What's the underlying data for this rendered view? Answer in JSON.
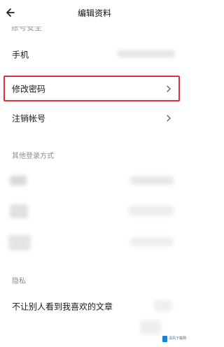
{
  "header": {
    "title": "编辑资料",
    "back": "back-arrow-icon"
  },
  "account_section_partial": "账号安全",
  "rows": {
    "phone": "手机",
    "change_password": "修改密码",
    "cancel_account": "注销帐号"
  },
  "other_login_title": "其他登录方式",
  "privacy_title": "隐私",
  "privacy_toggle_label": "不让别人看到我喜欢的文章",
  "watermark": {
    "text": "清风下载网"
  },
  "colors": {
    "highlight": "#d8313a",
    "blur": "#e6e6e6",
    "section_text": "#8c8c8c"
  }
}
